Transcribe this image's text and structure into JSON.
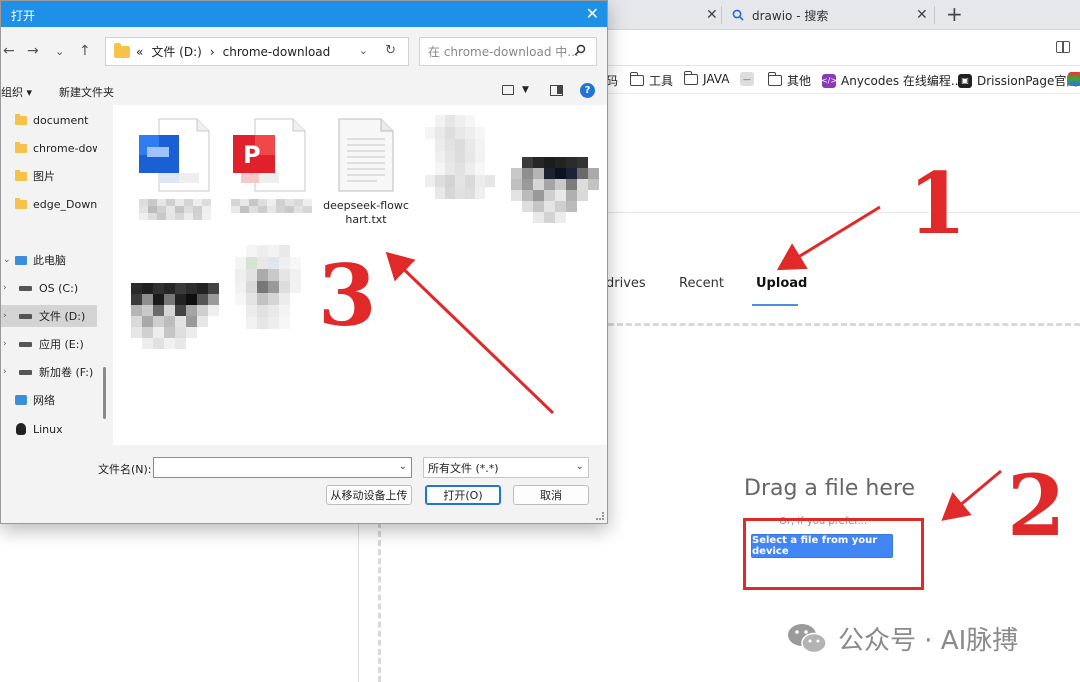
{
  "browser": {
    "tabs": [
      {
        "title": ""
      },
      {
        "title": "drawio - 搜索"
      }
    ],
    "bookmarks": [
      {
        "label": "码"
      },
      {
        "label": "工具"
      },
      {
        "label": "JAVA"
      },
      {
        "label": "其他"
      },
      {
        "label": "Anycodes 在线编程..."
      },
      {
        "label": "DrissionPage官网"
      }
    ]
  },
  "drawio": {
    "source_tabs": [
      "drives",
      "Recent",
      "Upload"
    ],
    "active_tab": "Upload",
    "drag_text": "Drag a file here",
    "or_text": "Or, if you prefer...",
    "select_button": "Select a file from your device",
    "accent_color": "#4285f4"
  },
  "annotations": {
    "numbers": [
      "1",
      "2",
      "3"
    ],
    "color": "#e02a2a"
  },
  "watermark": {
    "text": "公众号 · AI脉搏"
  },
  "file_dialog": {
    "title": "打开",
    "title_color": "#1e90e8",
    "path": {
      "prefix": "«",
      "segments": [
        "文件 (D:)",
        "›",
        "chrome-download"
      ]
    },
    "search_placeholder": "在 chrome-download 中...",
    "toolbar": {
      "organize": "组织 ▾",
      "new_folder": "新建文件夹"
    },
    "sidebar": [
      {
        "label": "document",
        "type": "folder"
      },
      {
        "label": "chrome-download",
        "type": "folder"
      },
      {
        "label": "图片",
        "type": "folder"
      },
      {
        "label": "edge_Download",
        "type": "folder"
      },
      {
        "label": "此电脑",
        "type": "pc"
      },
      {
        "label": "OS (C:)",
        "type": "drive"
      },
      {
        "label": "文件 (D:)",
        "type": "drive",
        "selected": true
      },
      {
        "label": "应用 (E:)",
        "type": "drive"
      },
      {
        "label": "新加卷 (F:)",
        "type": "drive"
      },
      {
        "label": "网络",
        "type": "network"
      },
      {
        "label": "Linux",
        "type": "linux"
      }
    ],
    "files": [
      {
        "label": "",
        "icon": "word-doc-icon"
      },
      {
        "label": "",
        "icon": "powerpoint-icon"
      },
      {
        "label": "deepseek-flowchart.txt",
        "icon": "text-file-icon"
      },
      {
        "label": "",
        "icon": "blurred-file-icon"
      },
      {
        "label": "",
        "icon": "blurred-image-icon"
      },
      {
        "label": "",
        "icon": "blurred-image-icon"
      },
      {
        "label": "",
        "icon": "blurred-file-icon"
      }
    ],
    "filename_label": "文件名(N):",
    "filename_value": "",
    "filetype_value": "所有文件 (*.*)",
    "buttons": {
      "mobile_upload": "从移动设备上传",
      "open": "打开(O)",
      "cancel": "取消"
    }
  }
}
